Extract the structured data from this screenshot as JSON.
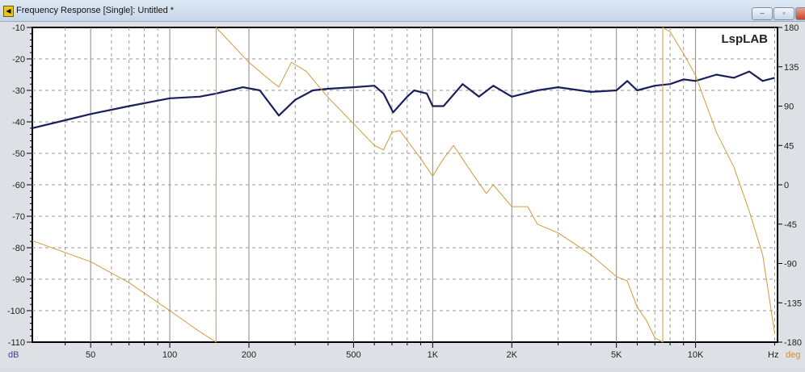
{
  "window": {
    "title": "Frequency Response [Single]: Untitled *",
    "minimize": "–",
    "maximize": "▫",
    "close": "x"
  },
  "chart_data": {
    "type": "line",
    "title": "LspLAB",
    "xscale": "log",
    "xlim": [
      30,
      20500
    ],
    "ylim": [
      -110,
      -10
    ],
    "y2lim": [
      -180,
      180
    ],
    "xlabel": "Hz",
    "ylabel": "dB",
    "y2label": "deg",
    "xticks": [
      {
        "v": 50,
        "l": "50"
      },
      {
        "v": 100,
        "l": "100"
      },
      {
        "v": 200,
        "l": "200"
      },
      {
        "v": 500,
        "l": "500"
      },
      {
        "v": 1000,
        "l": "1K"
      },
      {
        "v": 2000,
        "l": "2K"
      },
      {
        "v": 5000,
        "l": "5K"
      },
      {
        "v": 10000,
        "l": "10K"
      }
    ],
    "yticks": [
      -10,
      -20,
      -30,
      -40,
      -50,
      -60,
      -70,
      -80,
      -90,
      -100,
      -110
    ],
    "y2ticks": [
      180,
      135,
      90,
      45,
      0,
      -45,
      -90,
      -135,
      -180
    ],
    "grid": true,
    "colors": {
      "magnitude": "#1a1f5c",
      "phase": "#d49a3a",
      "dB": "#3344aa",
      "deg": "#e08a20"
    },
    "series": [
      {
        "name": "Magnitude (dB)",
        "axis": "left",
        "x": [
          30,
          40,
          50,
          70,
          100,
          130,
          150,
          190,
          220,
          260,
          300,
          350,
          400,
          500,
          600,
          650,
          707,
          800,
          850,
          950,
          1000,
          1100,
          1300,
          1500,
          1700,
          2000,
          2500,
          3000,
          4000,
          5000,
          5500,
          6000,
          7000,
          8000,
          9000,
          10000,
          12000,
          14000,
          16000,
          18000,
          20000
        ],
        "y": [
          -42,
          -39.5,
          -37.5,
          -35,
          -32.5,
          -32,
          -31,
          -29,
          -30,
          -38,
          -33,
          -30,
          -29.5,
          -29,
          -28.5,
          -31,
          -37,
          -32,
          -30,
          -31,
          -35,
          -35,
          -28,
          -32,
          -28.5,
          -32,
          -30,
          -29,
          -30.5,
          -30,
          -27,
          -30,
          -28.5,
          -28,
          -26.5,
          -27,
          -25,
          -26,
          -24,
          -27,
          -26
        ]
      },
      {
        "name": "Phase (deg)",
        "axis": "right",
        "x": [
          30,
          50,
          70,
          100,
          130,
          150,
          150.01,
          200,
          240,
          260,
          290,
          330,
          400,
          500,
          600,
          650,
          700,
          750,
          900,
          1000,
          1100,
          1200,
          1400,
          1600,
          1700,
          2000,
          2300,
          2500,
          3000,
          4000,
          5000,
          5500,
          6000,
          6500,
          7000,
          7500,
          7500.01,
          8000,
          9000,
          10000,
          12000,
          14000,
          16000,
          18000,
          20000
        ],
        "y": [
          -64,
          -88,
          -112,
          -144,
          -168,
          -180,
          180,
          140,
          120,
          112,
          140,
          130,
          100,
          70,
          45,
          40,
          60,
          62,
          30,
          10,
          30,
          45,
          15,
          -10,
          0,
          -25,
          -25,
          -45,
          -55,
          -80,
          -105,
          -110,
          -140,
          -155,
          -175,
          -180,
          180,
          175,
          150,
          125,
          60,
          20,
          -30,
          -80,
          -170
        ]
      }
    ]
  }
}
